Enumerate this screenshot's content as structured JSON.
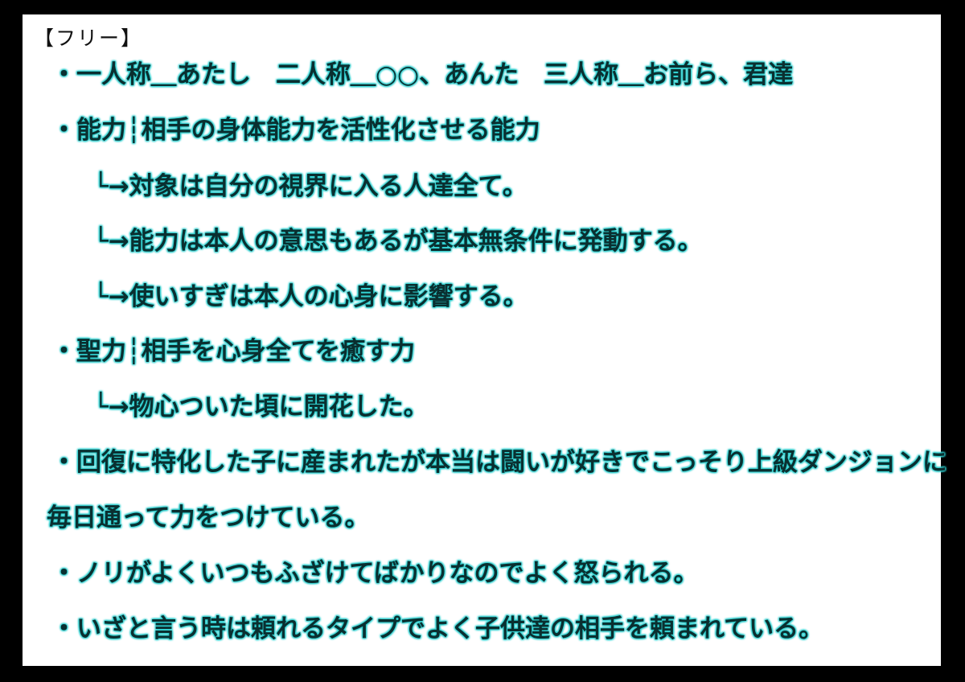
{
  "header": "【フリー】",
  "lines": [
    "・一人称＿あたし　二人称＿○○、あんた　三人称＿お前ら、君達",
    "・能力┆相手の身体能力を活性化させる能力",
    "└→対象は自分の視界に入る人達全て。",
    "└→能力は本人の意思もあるが基本無条件に発動する。",
    "└→使いすぎは本人の心身に影響する。",
    "・聖力┆相手を心身全てを癒す力",
    "└→物心ついた頃に開花した。",
    "・回復に特化した子に産まれたが本当は闘いが好きでこっそり上級ダンジョンに",
    "毎日通って力をつけている。",
    "・ノリがよくいつもふざけてばかりなのでよく怒られる。",
    "・いざと言う時は頼れるタイプでよく子供達の相手を頼まれている。"
  ],
  "colors": {
    "background": "#000000",
    "sheet": "#ffffff",
    "text": "#0a2f30",
    "glow": "#2fd0d0"
  }
}
